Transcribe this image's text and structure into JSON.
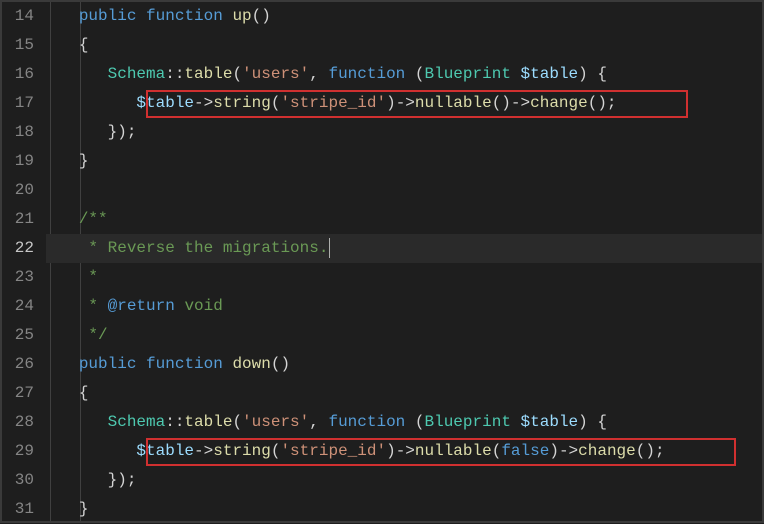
{
  "line_numbers": [
    "14",
    "15",
    "16",
    "17",
    "18",
    "19",
    "20",
    "21",
    "22",
    "23",
    "24",
    "25",
    "26",
    "27",
    "28",
    "29",
    "30",
    "31"
  ],
  "active_line_index": 8,
  "tokens": {
    "public": "public",
    "function": "function",
    "up": "up",
    "down": "down",
    "openParen": "()",
    "openBrace": "{",
    "closeBrace": "}",
    "closeBraceParen": "});",
    "schema": "Schema",
    "dcolon": "::",
    "table": "table",
    "lparen": "(",
    "rparen": ")",
    "users": "'users'",
    "comma": ", ",
    "blueprint": "Blueprint",
    "tableVar": "$table",
    "closeBraceSpace": ") {",
    "arrow": "->",
    "string": "string",
    "stripeId": "'stripe_id'",
    "nullable": "nullable",
    "change": "change",
    "semi": "();",
    "false": "false",
    "cmtOpen": "/**",
    "cmtLine1": " * Reverse the migrations.",
    "cmtLine2": " *",
    "cmtReturn": " * @return void",
    "cmtClose": " */"
  }
}
